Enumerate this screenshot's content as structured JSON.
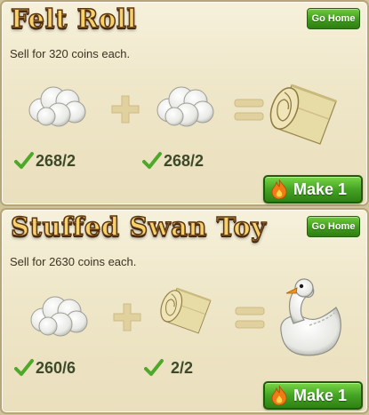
{
  "recipes": [
    {
      "title": "Felt Roll",
      "go_home_label": "Go Home",
      "sell_text": "Sell for 320 coins each.",
      "inputs": [
        {
          "item": "cotton-wool-icon",
          "count": "268/2"
        },
        {
          "item": "cotton-wool-icon",
          "count": "268/2"
        }
      ],
      "output": "felt-roll-icon",
      "make_label": "Make 1"
    },
    {
      "title": "Stuffed Swan Toy",
      "go_home_label": "Go Home",
      "sell_text": "Sell for 2630 coins each.",
      "inputs": [
        {
          "item": "cotton-wool-icon",
          "count": "260/6"
        },
        {
          "item": "felt-roll-icon",
          "count": "2/2"
        }
      ],
      "output": "swan-toy-icon",
      "make_label": "Make 1"
    }
  ],
  "colors": {
    "title_fill": "#f7d26a",
    "title_outline": "#5a3413",
    "button_green": "#44a324",
    "operator_tan": "#e0d19e",
    "card_bg": "#f3ecd2"
  }
}
